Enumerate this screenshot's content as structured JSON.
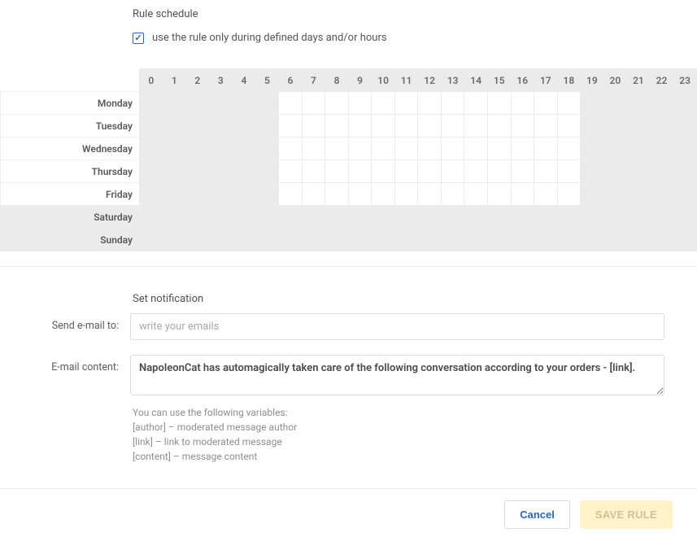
{
  "schedule": {
    "title": "Rule schedule",
    "checkbox_label": "use the rule only during defined days and/or hours",
    "checkbox_checked": true,
    "hours": [
      "0",
      "1",
      "2",
      "3",
      "4",
      "5",
      "6",
      "7",
      "8",
      "9",
      "10",
      "11",
      "12",
      "13",
      "14",
      "15",
      "16",
      "17",
      "18",
      "19",
      "20",
      "21",
      "22",
      "23"
    ],
    "days": [
      {
        "name": "Monday",
        "weekend": false
      },
      {
        "name": "Tuesday",
        "weekend": false
      },
      {
        "name": "Wednesday",
        "weekend": false
      },
      {
        "name": "Thursday",
        "weekend": false
      },
      {
        "name": "Friday",
        "weekend": false
      },
      {
        "name": "Saturday",
        "weekend": true
      },
      {
        "name": "Sunday",
        "weekend": true
      }
    ],
    "active_hours_weekday": {
      "start": 6,
      "end": 18
    }
  },
  "notification": {
    "title": "Set notification",
    "email_label": "Send e-mail to:",
    "email_placeholder": "write your emails",
    "email_value": "",
    "content_label": "E-mail content:",
    "content_value": "NapoleonCat has automagically taken care of the following conversation according to your orders - [link].",
    "hint_intro": "You can use the following variables:",
    "hints": [
      "[author] – moderated message author",
      "[link] – link to moderated message",
      "[content] – message content"
    ]
  },
  "footer": {
    "cancel_label": "Cancel",
    "save_label": "SAVE RULE"
  }
}
